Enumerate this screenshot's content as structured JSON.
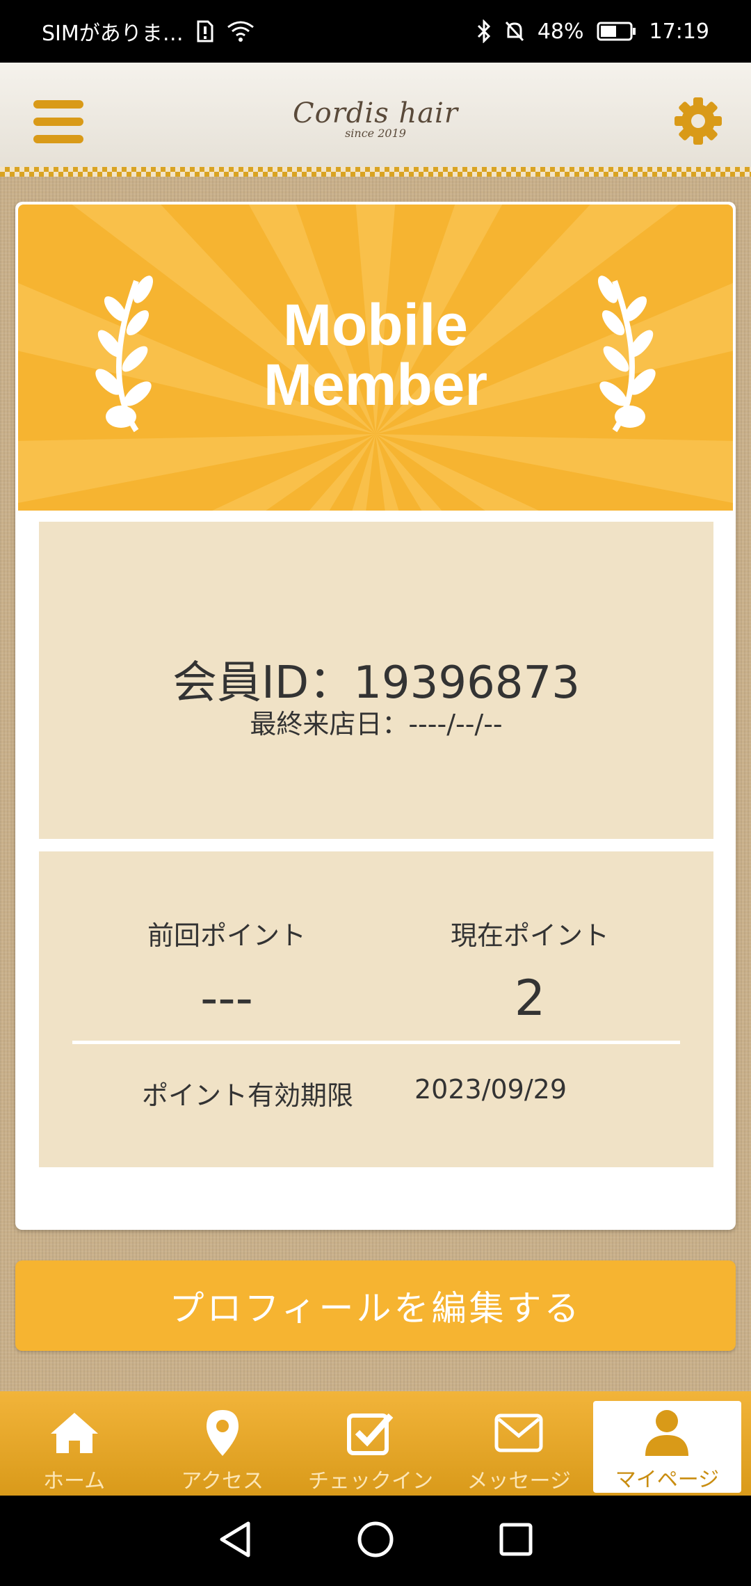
{
  "status_bar": {
    "carrier": "SIMがありま…",
    "battery": "48%",
    "time": "17:19"
  },
  "header": {
    "brand": "Cordis hair",
    "since": "since 2019"
  },
  "banner": {
    "line1": "Mobile",
    "line2": "Member"
  },
  "member": {
    "id_text": "会員ID：19396873",
    "last_visit_text": "最終来店日：----/--/--"
  },
  "points": {
    "previous_label": "前回ポイント",
    "previous_value": "---",
    "current_label": "現在ポイント",
    "current_value": "2",
    "expiry_label": "ポイント有効期限",
    "expiry_value": "2023/09/29"
  },
  "edit_profile_label": "プロフィールを編集する",
  "tabs": [
    {
      "label": "ホーム",
      "icon": "home-icon"
    },
    {
      "label": "アクセス",
      "icon": "location-pin-icon"
    },
    {
      "label": "チェックイン",
      "icon": "checkbox-icon"
    },
    {
      "label": "メッセージ",
      "icon": "envelope-icon"
    },
    {
      "label": "マイページ",
      "icon": "user-icon",
      "active": true
    }
  ],
  "colors": {
    "accent": "#f6b431",
    "panel": "#f0e2c6",
    "icon_brown": "#d99a18"
  }
}
